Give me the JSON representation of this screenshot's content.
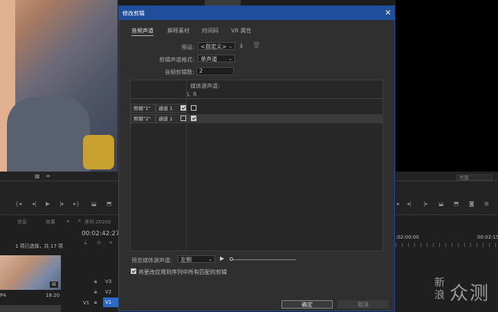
{
  "app": {
    "left_panel": {
      "tabs": [
        "信息",
        "效果"
      ],
      "selection_info": "1 项已选择，共 17 项",
      "clip_label": "P4",
      "clip_duration": "18:20"
    },
    "timeline": {
      "tab": "序列 20200",
      "timecode": "00:02:42:27",
      "ruler_left": ":02:00:00",
      "ruler_right": "00:02:15",
      "tracks": [
        "V3",
        "V2",
        "V1"
      ],
      "source_track": "V1"
    },
    "right_dropdown": "完整"
  },
  "dialog": {
    "title": "修改剪辑",
    "tabs": [
      "音频声道",
      "解释素材",
      "时间码",
      "VR 属性"
    ],
    "active_tab": 0,
    "preset_label": "预设:",
    "preset_value": "<自定义>",
    "format_label": "剪辑声道格式:",
    "format_value": "单声道",
    "count_label": "音频剪辑数:",
    "count_value": "2",
    "table": {
      "media_header": "媒体源声道:",
      "channel_headers": [
        "L",
        "R"
      ],
      "rows": [
        {
          "clip": "剪辑\"1\"",
          "channel": "通道 1",
          "L": true,
          "R": false
        },
        {
          "clip": "剪辑\"2\"",
          "channel": "通道 1",
          "L": false,
          "R": true
        }
      ]
    },
    "preview_label": "预览媒体源声道:",
    "preview_value": "左侧",
    "apply_all_label": "将更改应用到序列中所有匹配的剪辑",
    "apply_all_checked": true,
    "ok_label": "确定",
    "cancel_label": "取消"
  },
  "watermark": {
    "line1": "新",
    "line2": "浪",
    "text": "众测"
  }
}
